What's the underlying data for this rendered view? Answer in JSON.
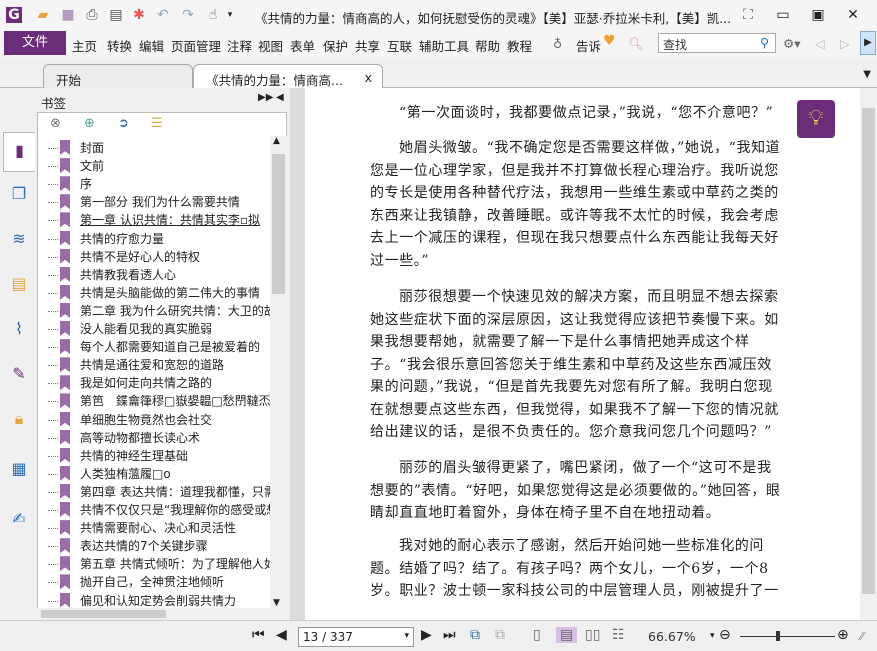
{
  "window": {
    "title": "《共情的力量：情商高的人，如何抚慰受伤的灵魂》【美】亚瑟·乔拉米卡利,【美】凯..."
  },
  "menu": {
    "file": "文件",
    "items": [
      "主页",
      "转换",
      "编辑",
      "页面管理",
      "注释",
      "视图",
      "表单",
      "保护",
      "共享",
      "互联",
      "辅助工具",
      "帮助",
      "教程"
    ],
    "tell": "告诉",
    "search_placeholder": "查找"
  },
  "tabs": [
    {
      "label": "开始"
    },
    {
      "label": "《共情的力量：情商高...",
      "close": "x"
    }
  ],
  "sidebar": {
    "title": "书签",
    "bookmarks": [
      "封面",
      "文前",
      "序",
      "第一部分 我们为什么需要共情",
      "第一章 认识共情：共情其实李▫拟",
      "共情的疗愈力量",
      "共情不是好心人的特权",
      "共情教我看透人心",
      "共情是头脑能做的第二伟大的事情",
      "第二章 我为什么研究共情：大卫的故",
      "没人能看见我的真实脆弱",
      "每个人都需要知道自己是被爱着的",
      "共情是通往爱和宽恕的道路",
      "我是如何走向共情之路的",
      "第笆　鍱龠箻穋□嶽嫢韞□愁閅韃㶨",
      "单细胞生物竟然也会社交",
      "高等动物都擅长读心术",
      "共情的神经生理基础",
      "人类独栯薀履□o",
      "第四章 表达共情：道理我都懂，只需",
      "共情不仅仅只是“我理解你的感受或想",
      "共情需要耐心、决心和灵活性",
      "表达共情的7个关键步骤",
      "第五章 共情式倾听：为了理解他人如",
      "抛开自己，全神贯注地倾听",
      "偏见和认知定势会削弱共情力"
    ]
  },
  "document": {
    "paragraphs": [
      [
        "“第一次面谈时，我都要做点记录，”我说，“您不介意吧？”"
      ],
      [
        "她眉头微皱。“我不确定您是否需要这样做，”她说，“我知道",
        "您是一位心理学家，但是我并不打算做长程心理治疗。我听说您",
        "的专长是使用各种替代疗法，我想用一些维生素或中草药之类的",
        "东西来让我镇静，改善睡眠。或许等我不太忙的时候，我会考虑",
        "去上一个减压的课程，但现在我只想要点什么东西能让我每天好",
        "过一些。”"
      ],
      [
        "丽莎很想要一个快速见效的解决方案，而且明显不想去探索",
        "她这些症状下面的深层原因，这让我觉得应该把节奏慢下来。如",
        "果我想要帮她，就需要了解一下是什么事情把她弄成这个样",
        "子。“我会很乐意回答您关于维生素和中草药及这些东西减压效",
        "果的问题，”我说，“但是首先我要先对您有所了解。我明白您现",
        "在就想要点这些东西，但我觉得，如果我不了解一下您的情况就",
        "给出建议的话，是很不负责任的。您介意我问您几个问题吗？”"
      ],
      [
        "丽莎的眉头皱得更紧了，嘴巴紧闭，做了一个“这可不是我",
        "想要的”表情。“好吧，如果您觉得这是必须要做的。”她回答，眼",
        "睛却直直地盯着窗外，身体在椅子里不自在地扭动着。"
      ],
      [
        "我对她的耐心表示了感谢，然后开始问她一些标准化的问",
        "题。结婚了吗？结了。有孩子吗？两个女儿，一个6岁，一个8",
        "岁。职业？波士顿一家科技公司的中层管理人员，刚被提升了一"
      ]
    ]
  },
  "status": {
    "page": "13 / 337",
    "zoom": "66.67%",
    "zoom_fraction": 0.5
  },
  "colors": {
    "accent": "#6b2c79",
    "bookmark": "#9b6ba8"
  }
}
